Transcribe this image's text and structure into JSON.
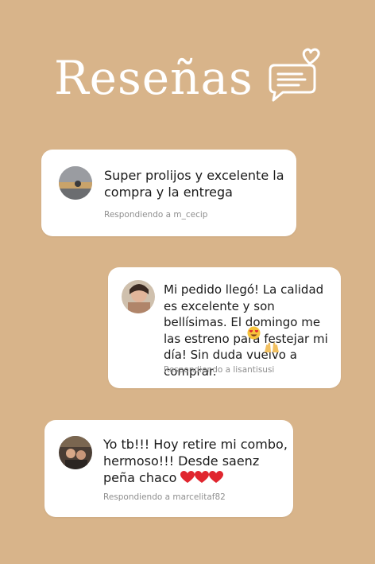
{
  "header": {
    "title": "Reseñas"
  },
  "reviews": [
    {
      "message": "Super prolijos y excelente la compra y la entrega",
      "reply": "Respondiendo a m_cecip"
    },
    {
      "message": "Mi pedido llegó! La calidad es excelente y son bellísimas. El domingo me las estreno para festejar mi día! Sin duda vuelvo a comprar.",
      "reply": "Respondiendo a lisantisusi"
    },
    {
      "message": "Yo tb!!! Hoy retire mi combo, hermoso!!! Desde saenz peña chaco",
      "reply": "Respondiendo a marcelitaf82"
    }
  ],
  "colors": {
    "background": "#d8b48a",
    "card": "#ffffff",
    "heart": "#e0262f"
  },
  "icons": [
    "chat-heart-icon",
    "heart-eyes-emoji-icon",
    "raised-hands-emoji-icon",
    "red-heart-icon"
  ]
}
